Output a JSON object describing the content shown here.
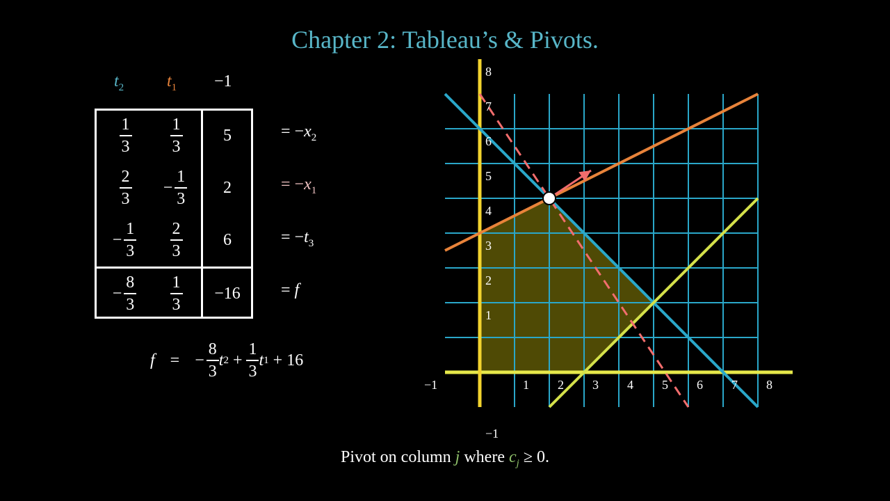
{
  "title": "Chapter 2: Tableau’s & Pivots.",
  "column_headers": [
    {
      "var": "t",
      "sub": "2",
      "color": "#58b6c8"
    },
    {
      "var": "t",
      "sub": "1",
      "color": "#e8833a"
    },
    {
      "text": "−1",
      "color": "#ffffff"
    }
  ],
  "tableau": {
    "rows": [
      {
        "c1": {
          "num": "1",
          "den": "3",
          "neg": ""
        },
        "c2": {
          "num": "1",
          "den": "3",
          "neg": ""
        },
        "c3": "5",
        "label_lhs": "= −",
        "label_var": "x",
        "label_sub": "2",
        "label_color": "#ffffff"
      },
      {
        "c1": {
          "num": "2",
          "den": "3",
          "neg": ""
        },
        "c2": {
          "num": "1",
          "den": "3",
          "neg": "−"
        },
        "c3": "2",
        "label_lhs": "= −",
        "label_var": "x",
        "label_sub": "1",
        "label_color": "#f2c4c4"
      },
      {
        "c1": {
          "num": "1",
          "den": "3",
          "neg": "−"
        },
        "c2": {
          "num": "2",
          "den": "3",
          "neg": ""
        },
        "c3": "6",
        "label_lhs": "= −",
        "label_var": "t",
        "label_sub": "3",
        "label_color": "#ffffff"
      },
      {
        "c1": {
          "num": "8",
          "den": "3",
          "neg": "−"
        },
        "c2": {
          "num": "1",
          "den": "3",
          "neg": ""
        },
        "c3": "−16",
        "label_lhs": "= ",
        "label_var": "f",
        "label_sub": "",
        "label_color": "#ffffff"
      }
    ]
  },
  "formula": {
    "lhs": "f",
    "eq": "=",
    "term1_sign": "−",
    "term1_num": "8",
    "term1_den": "3",
    "term1_var": "t",
    "term1_sub": "2",
    "plus1": "+",
    "term2_num": "1",
    "term2_den": "3",
    "term2_var": "t",
    "term2_sub": "1",
    "plus2": "+ 16"
  },
  "caption": {
    "pre": "Pivot on column ",
    "j": "j",
    "mid": " where ",
    "c": "c",
    "c_sub": "j",
    "post": " ≥ 0."
  },
  "chart_data": {
    "type": "line",
    "xlim": [
      -1,
      8
    ],
    "ylim": [
      -1,
      8
    ],
    "grid": true,
    "x_tick_labels": [
      "−1",
      "1",
      "2",
      "3",
      "4",
      "5",
      "6",
      "7",
      "8"
    ],
    "y_tick_labels": [
      "−1",
      "1",
      "2",
      "3",
      "4",
      "5",
      "6",
      "7",
      "8"
    ],
    "feasible_region": [
      [
        0,
        0
      ],
      [
        0,
        4
      ],
      [
        2,
        5
      ],
      [
        5,
        2
      ],
      [
        3,
        0
      ]
    ],
    "constraint_lines": [
      {
        "points": [
          [
            -1,
            8
          ],
          [
            8,
            -1
          ]
        ],
        "color": "#2aa7c9"
      },
      {
        "points": [
          [
            -1,
            3.5
          ],
          [
            8,
            8
          ]
        ],
        "color": "#e8833a"
      },
      {
        "points": [
          [
            2,
            -1
          ],
          [
            8,
            5
          ]
        ],
        "color": "#d4e04a"
      }
    ],
    "objective_line": {
      "points": [
        [
          0,
          8
        ],
        [
          6,
          -1
        ]
      ],
      "color": "#f26d6d"
    },
    "current_vertex": [
      2,
      5
    ],
    "direction_arrow": {
      "from": [
        2,
        5
      ],
      "to": [
        3.2,
        5.8
      ],
      "color": "#f26d6d"
    },
    "colors": {
      "grid": "#2aa7c9",
      "axis": "#f2d32e",
      "x_axis": "#e6e84a",
      "region": "#4f4a05"
    }
  }
}
